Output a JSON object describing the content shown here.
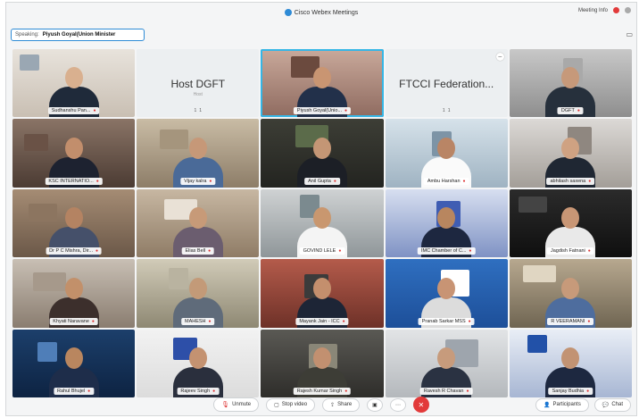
{
  "app": {
    "title": "Cisco Webex Meetings",
    "meeting_info": "Meeting Info"
  },
  "speaking": {
    "label": "Speaking:",
    "name": "Piyush Goyal(Union Minister"
  },
  "tiles": [
    {
      "name": "Sudhanshu Pan...",
      "kind": "video"
    },
    {
      "name": "Host DGFT",
      "kind": "text",
      "sub": "Host",
      "stats": [
        "1",
        "1"
      ]
    },
    {
      "name": "Piyush Goyal(Unio...",
      "kind": "video",
      "active": true
    },
    {
      "name": "FTCCI Federation...",
      "kind": "text",
      "sub": "",
      "stats": [
        "1",
        "1"
      ]
    },
    {
      "name": "DGFT",
      "kind": "video"
    },
    {
      "name": "KSC INTERNATIO...",
      "kind": "video"
    },
    {
      "name": "Vijay kalra",
      "kind": "video"
    },
    {
      "name": "Anil Gupta",
      "kind": "video"
    },
    {
      "name": "Ambu Harshan",
      "kind": "video"
    },
    {
      "name": "abhilash saxena",
      "kind": "video"
    },
    {
      "name": "Dr P C Mishra, Dir...",
      "kind": "video"
    },
    {
      "name": "Elias Bell",
      "kind": "video"
    },
    {
      "name": "GOVIND LELE",
      "kind": "video"
    },
    {
      "name": "IMC Chamber of C...",
      "kind": "video"
    },
    {
      "name": "Jagdish Fatnani",
      "kind": "video"
    },
    {
      "name": "Khyati Naravane",
      "kind": "video"
    },
    {
      "name": "MAHESH",
      "kind": "video"
    },
    {
      "name": "Mayank Jain - ICC",
      "kind": "video"
    },
    {
      "name": "Pranab Sarkar MSS",
      "kind": "video"
    },
    {
      "name": "R VEERAMANI",
      "kind": "video"
    },
    {
      "name": "Rahul Bhujel",
      "kind": "video"
    },
    {
      "name": "Rajeev Singh",
      "kind": "video"
    },
    {
      "name": "Rajesh Kumar Singh",
      "kind": "video"
    },
    {
      "name": "Ravesh R Chavan",
      "kind": "video"
    },
    {
      "name": "Sanjay Budhia",
      "kind": "video"
    }
  ],
  "controls": {
    "unmute": "Unmute",
    "stop_video": "Stop video",
    "share": "Share",
    "participants": "Participants",
    "chat": "Chat"
  }
}
